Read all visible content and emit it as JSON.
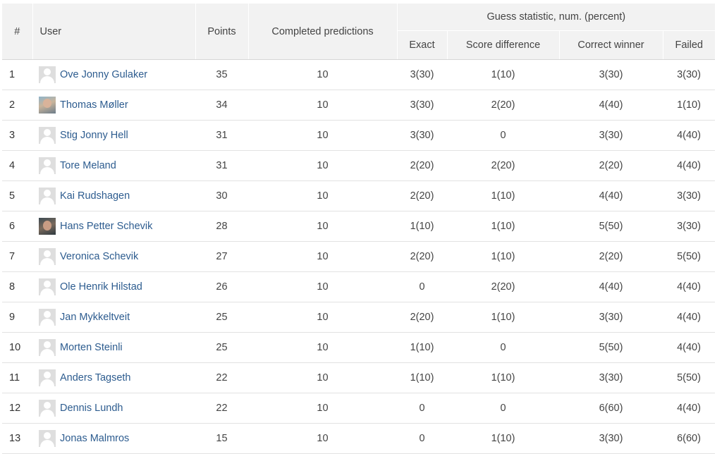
{
  "header": {
    "rank": "#",
    "user": "User",
    "points": "Points",
    "completed": "Completed predictions",
    "group": "Guess statistic, num. (percent)",
    "exact": "Exact",
    "score_difference": "Score difference",
    "correct_winner": "Correct winner",
    "failed": "Failed"
  },
  "rows": [
    {
      "rank": "1",
      "name": "Ove Jonny Gulaker",
      "avatar": "default-avatar-icon",
      "points": "35",
      "completed": "10",
      "exact": "3(30)",
      "diff": "1(10)",
      "winner": "3(30)",
      "failed": "3(30)"
    },
    {
      "rank": "2",
      "name": "Thomas Møller",
      "avatar": "photo-avatar",
      "points": "34",
      "completed": "10",
      "exact": "3(30)",
      "diff": "2(20)",
      "winner": "4(40)",
      "failed": "1(10)"
    },
    {
      "rank": "3",
      "name": "Stig Jonny Hell",
      "avatar": "default-avatar-icon",
      "points": "31",
      "completed": "10",
      "exact": "3(30)",
      "diff": "0",
      "winner": "3(30)",
      "failed": "4(40)"
    },
    {
      "rank": "4",
      "name": "Tore Meland",
      "avatar": "default-avatar-icon",
      "points": "31",
      "completed": "10",
      "exact": "2(20)",
      "diff": "2(20)",
      "winner": "2(20)",
      "failed": "4(40)"
    },
    {
      "rank": "5",
      "name": "Kai Rudshagen",
      "avatar": "default-avatar-icon",
      "points": "30",
      "completed": "10",
      "exact": "2(20)",
      "diff": "1(10)",
      "winner": "4(40)",
      "failed": "3(30)"
    },
    {
      "rank": "6",
      "name": "Hans Petter Schevik",
      "avatar": "photo-avatar",
      "points": "28",
      "completed": "10",
      "exact": "1(10)",
      "diff": "1(10)",
      "winner": "5(50)",
      "failed": "3(30)"
    },
    {
      "rank": "7",
      "name": "Veronica Schevik",
      "avatar": "default-avatar-icon",
      "points": "27",
      "completed": "10",
      "exact": "2(20)",
      "diff": "1(10)",
      "winner": "2(20)",
      "failed": "5(50)"
    },
    {
      "rank": "8",
      "name": "Ole Henrik Hilstad",
      "avatar": "default-avatar-icon",
      "points": "26",
      "completed": "10",
      "exact": "0",
      "diff": "2(20)",
      "winner": "4(40)",
      "failed": "4(40)"
    },
    {
      "rank": "9",
      "name": "Jan Mykkeltveit",
      "avatar": "default-avatar-icon",
      "points": "25",
      "completed": "10",
      "exact": "2(20)",
      "diff": "1(10)",
      "winner": "3(30)",
      "failed": "4(40)"
    },
    {
      "rank": "10",
      "name": "Morten Steinli",
      "avatar": "default-avatar-icon",
      "points": "25",
      "completed": "10",
      "exact": "1(10)",
      "diff": "0",
      "winner": "5(50)",
      "failed": "4(40)"
    },
    {
      "rank": "11",
      "name": "Anders Tagseth",
      "avatar": "default-avatar-icon",
      "points": "22",
      "completed": "10",
      "exact": "1(10)",
      "diff": "1(10)",
      "winner": "3(30)",
      "failed": "5(50)"
    },
    {
      "rank": "12",
      "name": "Dennis Lundh",
      "avatar": "default-avatar-icon",
      "points": "22",
      "completed": "10",
      "exact": "0",
      "diff": "0",
      "winner": "6(60)",
      "failed": "4(40)"
    },
    {
      "rank": "13",
      "name": "Jonas Malmros",
      "avatar": "default-avatar-icon",
      "points": "15",
      "completed": "10",
      "exact": "0",
      "diff": "1(10)",
      "winner": "3(30)",
      "failed": "6(60)"
    }
  ],
  "colors": {
    "header_bg": "#f2f2f2",
    "link": "#2d5c8f",
    "row_border": "#e2e2e2"
  }
}
